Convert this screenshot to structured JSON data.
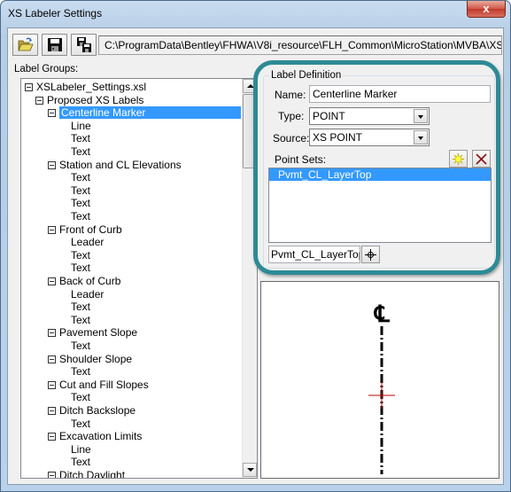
{
  "window": {
    "title": "XS Labeler Settings",
    "close_label": "x"
  },
  "toolbar": {
    "buttons": [
      {
        "icon": "open-folder-icon",
        "tooltip": "Open"
      },
      {
        "icon": "save-disk-icon",
        "tooltip": "Save"
      },
      {
        "icon": "save-as-disks-icon",
        "tooltip": "Save As"
      }
    ],
    "file_path": "C:\\ProgramData\\Bentley\\FHWA\\V8i_resource\\FLH_Common\\MicroStation\\MVBA\\XSLabeler_S"
  },
  "label_groups": {
    "label": "Label Groups:",
    "tree": [
      {
        "text": "XSLabeler_Settings.xsl",
        "level": 0,
        "expander": true
      },
      {
        "text": "Proposed XS Labels",
        "level": 1,
        "expander": true
      },
      {
        "text": "Centerline Marker",
        "level": 2,
        "expander": true,
        "selected": true
      },
      {
        "text": "Line",
        "level": 3
      },
      {
        "text": "Text",
        "level": 3
      },
      {
        "text": "Text",
        "level": 3
      },
      {
        "text": "Station and CL Elevations",
        "level": 2,
        "expander": true
      },
      {
        "text": "Text",
        "level": 3
      },
      {
        "text": "Text",
        "level": 3
      },
      {
        "text": "Text",
        "level": 3
      },
      {
        "text": "Text",
        "level": 3
      },
      {
        "text": "Front of Curb",
        "level": 2,
        "expander": true
      },
      {
        "text": "Leader",
        "level": 3
      },
      {
        "text": "Text",
        "level": 3
      },
      {
        "text": "Text",
        "level": 3
      },
      {
        "text": "Back of Curb",
        "level": 2,
        "expander": true
      },
      {
        "text": "Leader",
        "level": 3
      },
      {
        "text": "Text",
        "level": 3
      },
      {
        "text": "Text",
        "level": 3
      },
      {
        "text": "Pavement Slope",
        "level": 2,
        "expander": true
      },
      {
        "text": "Text",
        "level": 3
      },
      {
        "text": "Shoulder Slope",
        "level": 2,
        "expander": true
      },
      {
        "text": "Text",
        "level": 3
      },
      {
        "text": "Cut and Fill Slopes",
        "level": 2,
        "expander": true
      },
      {
        "text": "Text",
        "level": 3
      },
      {
        "text": "Ditch Backslope",
        "level": 2,
        "expander": true
      },
      {
        "text": "Text",
        "level": 3
      },
      {
        "text": "Excavation Limits",
        "level": 2,
        "expander": true
      },
      {
        "text": "Line",
        "level": 3
      },
      {
        "text": "Text",
        "level": 3
      },
      {
        "text": "Ditch Daylight",
        "level": 2,
        "expander": true
      }
    ]
  },
  "label_definition": {
    "title": "Label Definition",
    "name_label": "Name:",
    "name_value": "Centerline Marker",
    "type_label": "Type:",
    "type_value": "POINT",
    "source_label": "Source:",
    "source_value": "XS POINT",
    "point_sets_label": "Point Sets:",
    "point_sets": [
      "Pvmt_CL_LayerTop"
    ],
    "point_set_field_value": "Pvmt_CL_LayerTop",
    "add_icon": "new-star-icon",
    "delete_icon": "delete-x-icon",
    "pick_icon": "crosshair-pick-icon"
  },
  "preview": {
    "symbol": "centerline-symbol",
    "line_style": "dash-dot",
    "marker_color": "#c00000"
  },
  "colors": {
    "highlight_ring": "#2e8a96",
    "selection": "#3399ff"
  }
}
